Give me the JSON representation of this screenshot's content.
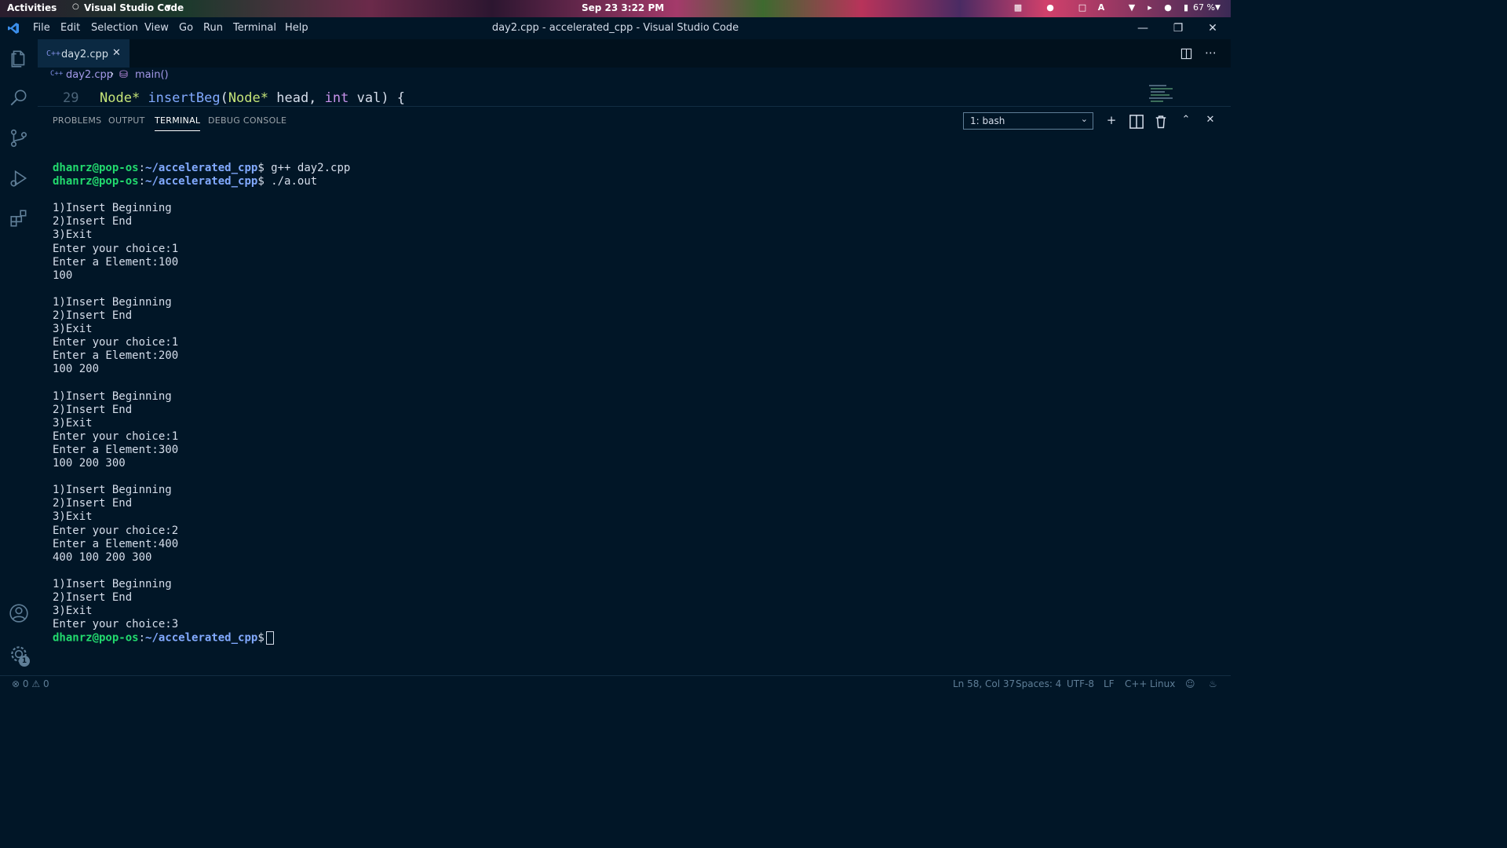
{
  "topbar": {
    "activities": "Activities",
    "app_menu": "Visual Studio Code",
    "clock": "Sep 23  3:22 PM",
    "battery": "67 %"
  },
  "window": {
    "title": "day2.cpp - accelerated_cpp - Visual Studio Code",
    "menu": [
      "File",
      "Edit",
      "Selection",
      "View",
      "Go",
      "Run",
      "Terminal",
      "Help"
    ]
  },
  "tab": {
    "icon_text": "C++",
    "label": "day2.cpp"
  },
  "breadcrumb": {
    "file": "day2.cpp",
    "symbol": "main()"
  },
  "editor": {
    "line_number": "29",
    "code_type": "Node*",
    "code_fn": "insertBeg",
    "code_param_type": "Node*",
    "code_param_name": " head, ",
    "code_int": "int",
    "code_tail": " val) {"
  },
  "panel": {
    "tabs": [
      "PROBLEMS",
      "OUTPUT",
      "TERMINAL",
      "DEBUG CONSOLE"
    ],
    "active_tab": "TERMINAL",
    "shell": "1: bash"
  },
  "terminal": {
    "prompt_user": "dhanrz@pop-os",
    "prompt_path": "~/accelerated_cpp",
    "cmd1": " g++ day2.cpp",
    "cmd2": " ./a.out",
    "lines": [
      "",
      "1)Insert Beginning",
      "2)Insert End",
      "3)Exit",
      "Enter your choice:1",
      "Enter a Element:100",
      "100",
      "",
      "1)Insert Beginning",
      "2)Insert End",
      "3)Exit",
      "Enter your choice:1",
      "Enter a Element:200",
      "100 200",
      "",
      "1)Insert Beginning",
      "2)Insert End",
      "3)Exit",
      "Enter your choice:1",
      "Enter a Element:300",
      "100 200 300",
      "",
      "1)Insert Beginning",
      "2)Insert End",
      "3)Exit",
      "Enter your choice:2",
      "Enter a Element:400",
      "400 100 200 300",
      "",
      "1)Insert Beginning",
      "2)Insert End",
      "3)Exit",
      "Enter your choice:3"
    ]
  },
  "statusbar": {
    "errors": "0",
    "warnings": "0",
    "position": "Ln 58, Col 37",
    "spaces": "Spaces: 4",
    "encoding": "UTF-8",
    "eol": "LF",
    "language": "C++",
    "os": "Linux"
  },
  "activity": {
    "settings_badge": "1"
  },
  "colors": {
    "background": "#011627",
    "prompt_user": "#22da6e",
    "prompt_path": "#82aaff",
    "accent": "#7c8ce0"
  }
}
